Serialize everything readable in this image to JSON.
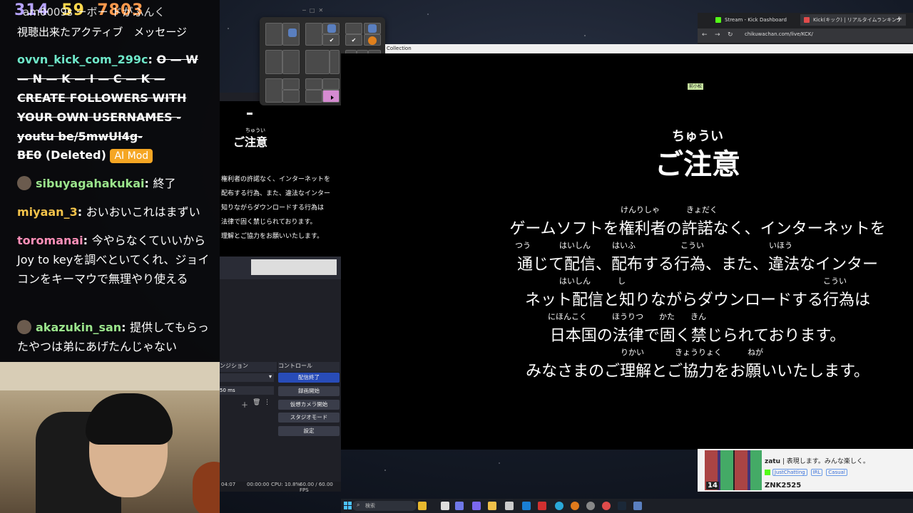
{
  "chat": {
    "counter": [
      "314",
      "59",
      "7803"
    ],
    "top_line1": "am0009s  ーボー ドがふんく",
    "top_line2": "視聴出来たアクティブ　メッセージ",
    "messages": [
      {
        "user": "ovvn_kick_com_299c",
        "text": "O — W — N — K — I — C — K — CREATE FOLLOWERS WITH YOUR OWN USERNAMES - youtu be/5mwUl4g-",
        "struck": true,
        "user_color": "#6ee6c8"
      },
      {
        "user": "BE0",
        "text": "(Deleted)",
        "badge": "AI Mod"
      },
      {
        "user": "sibuyagahakukai",
        "text": "終了",
        "user_color": "#9be58c"
      },
      {
        "user": "miyaan_3",
        "text": "おいおいこれはまずい",
        "user_color": "#f2c24a"
      },
      {
        "user": "toromanai",
        "text": "今やらなくていいからJoy to keyを調べといてくれ、ジョイコンをキーマウで無理やり使える",
        "user_color": "#ff8fb8"
      },
      {
        "user": "akazukin_san",
        "text": "提供してもらったやつは弟にあげたんじゃない",
        "user_color": "#9be58c"
      }
    ]
  },
  "obs": {
    "mini_title": "ご注意",
    "mini_ruby": "ちゅうい",
    "mini_lines": [
      "権利者の許諾なく、インターネットを",
      "配布する行為、また、違法なインター",
      "知りながらダウンロードする行為は",
      "法律で固く禁じられております。",
      "理解とご協力をお願いいたします。"
    ],
    "transitions_header": "ンジション",
    "duration": "50 ms",
    "controls_header": "コントロール",
    "buttons": [
      "配信終了",
      "録画開始",
      "仮想カメラ開始",
      "スタジオモード",
      "設定"
    ],
    "status_time": "04:07",
    "status_rec": "00:00:00",
    "status_cpu": "CPU: 10.8%",
    "status_fps": "60.00 / 60.00 FPS"
  },
  "browser": {
    "tabs": [
      "Stream - Kick Dashboard",
      "Kick(キック) | リアルタイムランキング"
    ],
    "url": "chikuwachan.com/live/KCK/"
  },
  "main": {
    "window_title": "Collection",
    "mini_badge": "前小松",
    "title_ruby": "ちゅうい",
    "title": "ご注意",
    "lines": [
      "ゲームソフトを権利者の許諾なく、インターネットを",
      "通じて配信、配布する行為、また、違法なインター",
      "ネット配信と知りながらダウンロードする行為は",
      "日本国の法律で固く禁じられております。",
      "みなさまのご理解とご協力をお願いいたします。"
    ],
    "rubies": [
      [
        "けんりしゃ",
        "きょだく"
      ],
      [
        "つう",
        "はいしん",
        "はいふ",
        "こうい",
        "いほう"
      ],
      [
        "はいしん",
        "し",
        "こうい"
      ],
      [
        "にほんこく",
        "ほうりつ",
        "かた",
        "きん"
      ],
      [
        "りかい",
        "きょうりょく",
        "ねが"
      ]
    ]
  },
  "kick": {
    "viewer_count": "14",
    "streamer": "zatu",
    "streamer_text": "表現します。みんな楽しく。",
    "tags": [
      "JustChatting",
      "IRL",
      "Casual"
    ],
    "next": "ZNK2525"
  },
  "taskbar": {
    "search_placeholder": "検索"
  },
  "colors": {
    "kick_green": "#53fc18",
    "obs_primary": "#284cb8",
    "badge": "#f5a623"
  }
}
